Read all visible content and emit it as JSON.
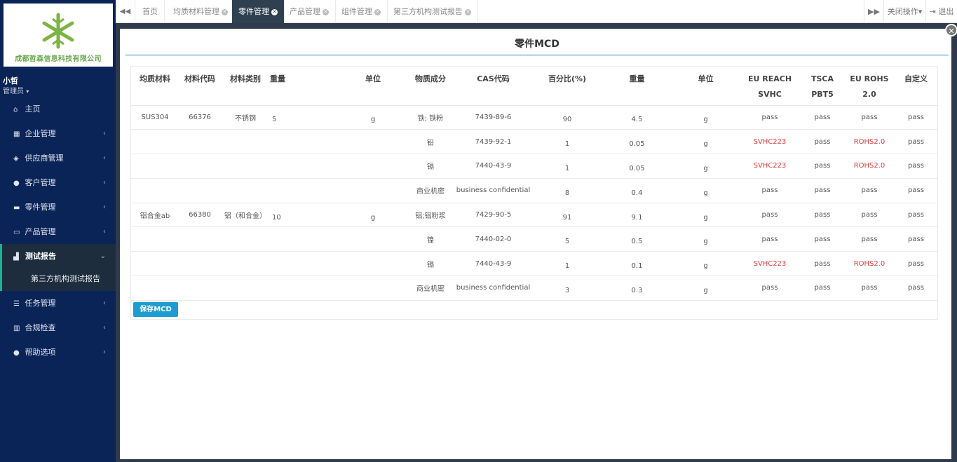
{
  "sidebar": {
    "company": "成都哲森信息科技有限公司",
    "user_name": "小哲",
    "user_role": "管理员",
    "items": [
      {
        "label": "主页",
        "icon": "home-icon",
        "glyph": "⌂",
        "arrow": ""
      },
      {
        "label": "企业管理",
        "icon": "film-icon",
        "glyph": "▦",
        "arrow": "‹"
      },
      {
        "label": "供应商管理",
        "icon": "cube-icon",
        "glyph": "◈",
        "arrow": "‹"
      },
      {
        "label": "客户管理",
        "icon": "user-icon",
        "glyph": "●",
        "arrow": "‹"
      },
      {
        "label": "零件管理",
        "icon": "briefcase-icon",
        "glyph": "▬",
        "arrow": "‹"
      },
      {
        "label": "产品管理",
        "icon": "folder-open-icon",
        "glyph": "▭",
        "arrow": "‹"
      },
      {
        "label": "测试报告",
        "icon": "area-chart-icon",
        "glyph": "▟",
        "arrow": "⌄"
      }
    ],
    "sub_item": "第三方机构测试报告",
    "items_after": [
      {
        "label": "任务管理",
        "icon": "list-icon",
        "glyph": "☰",
        "arrow": "‹"
      },
      {
        "label": "合规检查",
        "icon": "map-icon",
        "glyph": "▥",
        "arrow": "‹"
      },
      {
        "label": "帮助选项",
        "icon": "info-icon",
        "glyph": "●",
        "arrow": "‹"
      }
    ]
  },
  "tabs": {
    "items": [
      "首页",
      "均质材料管理",
      "零件管理",
      "产品管理",
      "组件管理",
      "第三方机构测试报告"
    ],
    "close_ops": "关闭操作",
    "logout": "退出"
  },
  "modal": {
    "title": "零件MCD",
    "save_button": "保存MCD"
  },
  "table": {
    "headers": [
      "均质材料",
      "材料代码",
      "材料类别",
      "重量",
      "单位",
      "物质成分",
      "CAS代码",
      "百分比(%)",
      "重量",
      "单位",
      "EU REACH SVHC",
      "TSCA PBT5",
      "EU ROHS 2.0",
      "自定义"
    ],
    "rows": [
      [
        "SUS304",
        "66376",
        "不锈钢",
        "5",
        "g",
        "铁; 铁粉",
        "7439-89-6",
        "90",
        "4.5",
        "g",
        "pass",
        "pass",
        "pass",
        "pass"
      ],
      [
        "",
        "",
        "",
        "",
        "",
        "铅",
        "7439-92-1",
        "1",
        "0.05",
        "g",
        "SVHC223",
        "pass",
        "ROHS2.0",
        "pass"
      ],
      [
        "",
        "",
        "",
        "",
        "",
        "镉",
        "7440-43-9",
        "1",
        "0.05",
        "g",
        "SVHC223",
        "pass",
        "ROHS2.0",
        "pass"
      ],
      [
        "",
        "",
        "",
        "",
        "",
        "商业机密",
        "business confidential",
        "8",
        "0.4",
        "g",
        "pass",
        "pass",
        "pass",
        "pass"
      ],
      [
        "铝合金ab",
        "66380",
        "铝（和合金）",
        "10",
        "g",
        "铝;铝粉浆",
        "7429-90-5",
        "91",
        "9.1",
        "g",
        "pass",
        "pass",
        "pass",
        "pass"
      ],
      [
        "",
        "",
        "",
        "",
        "",
        "镍",
        "7440-02-0",
        "5",
        "0.5",
        "g",
        "pass",
        "pass",
        "pass",
        "pass"
      ],
      [
        "",
        "",
        "",
        "",
        "",
        "镉",
        "7440-43-9",
        "1",
        "0.1",
        "g",
        "SVHC223",
        "pass",
        "ROHS2.0",
        "pass"
      ],
      [
        "",
        "",
        "",
        "",
        "",
        "商业机密",
        "business confidential",
        "3",
        "0.3",
        "g",
        "pass",
        "pass",
        "pass",
        "pass"
      ]
    ]
  }
}
